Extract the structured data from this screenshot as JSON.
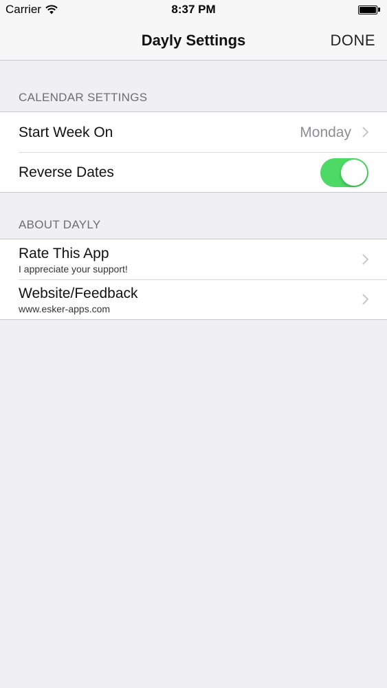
{
  "status_bar": {
    "carrier": "Carrier",
    "time": "8:37 PM",
    "wifi_icon": "wifi-icon",
    "battery_icon": "battery-icon"
  },
  "nav": {
    "title": "Dayly Settings",
    "done_label": "DONE"
  },
  "calendar_section": {
    "header": "CALENDAR SETTINGS",
    "start_week": {
      "label": "Start Week On",
      "value": "Monday"
    },
    "reverse_dates": {
      "label": "Reverse Dates",
      "enabled": true
    }
  },
  "about_section": {
    "header": "ABOUT DAYLY",
    "rate": {
      "label": "Rate This App",
      "subtitle": "I appreciate your support!"
    },
    "website": {
      "label": "Website/Feedback",
      "subtitle": "www.esker-apps.com"
    }
  },
  "colors": {
    "toggle_on": "#4cd964",
    "background": "#efeff4",
    "secondary_text": "#8e8e93"
  }
}
